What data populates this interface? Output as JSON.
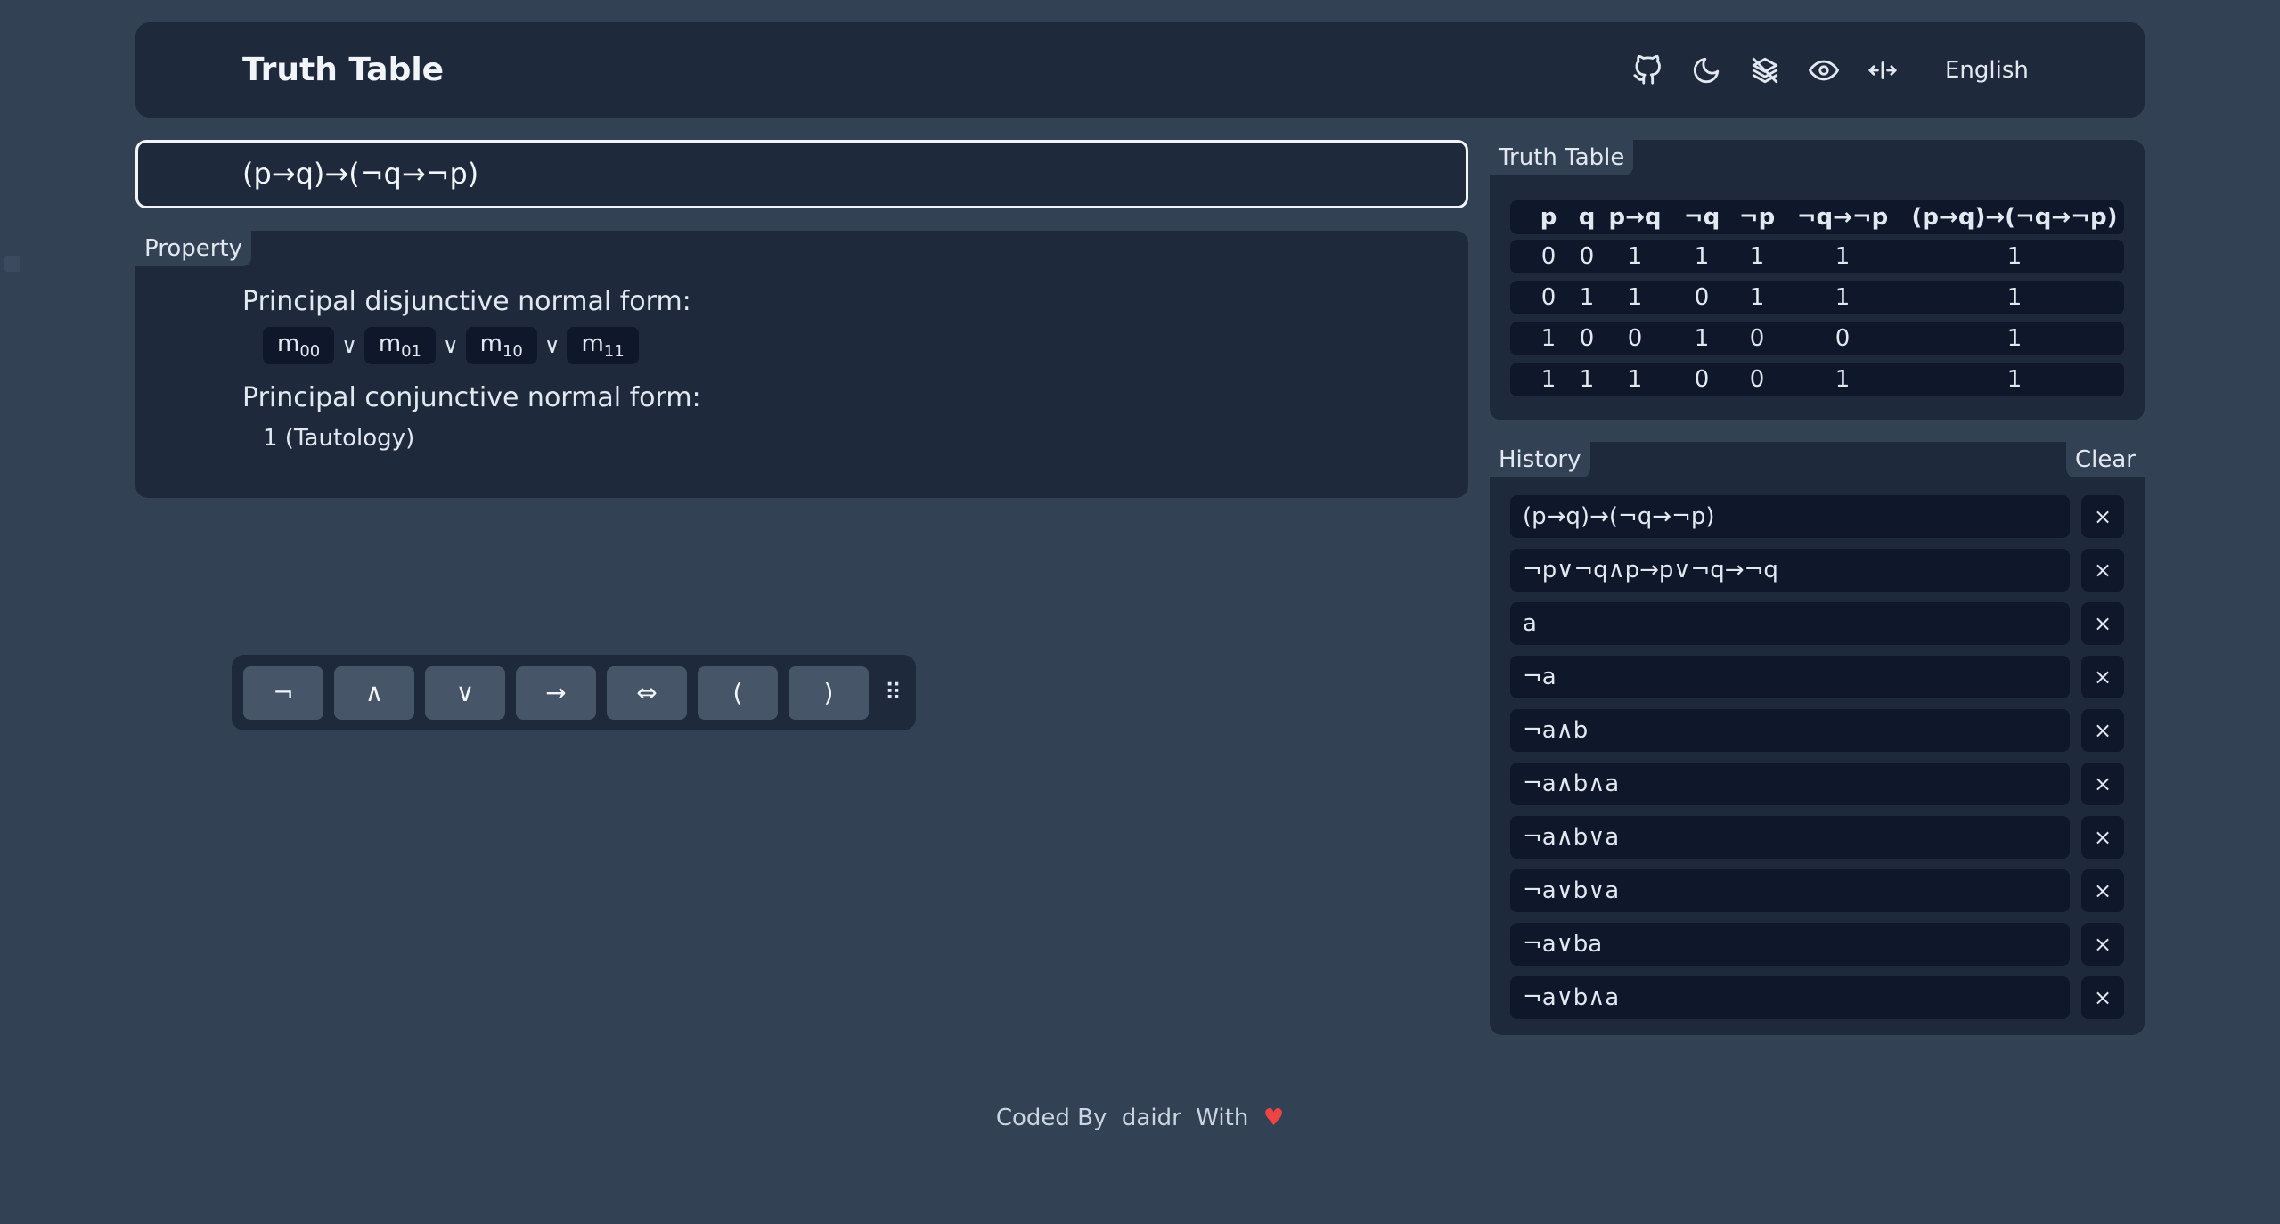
{
  "header": {
    "title": "Truth Table",
    "icons": [
      "github-icon",
      "moon-icon",
      "layers-off-icon",
      "eye-icon",
      "arrows-horizontal-icon"
    ],
    "language": "English"
  },
  "input": {
    "value": "(p→q)→(¬q→¬p)"
  },
  "property": {
    "tag": "Property",
    "pdnf_label": "Principal disjunctive normal form:",
    "minterms": [
      {
        "m": "m",
        "sub": "00"
      },
      {
        "m": "m",
        "sub": "01"
      },
      {
        "m": "m",
        "sub": "10"
      },
      {
        "m": "m",
        "sub": "11"
      }
    ],
    "or_symbol": "∨",
    "pcnf_label": "Principal conjunctive normal form:",
    "pcnf_value": "1 (Tautology)"
  },
  "keyboard": {
    "keys": [
      "¬",
      "∧",
      "∨",
      "→",
      "⇔",
      "(",
      ")"
    ],
    "drag_handle": "⠿"
  },
  "truth_table": {
    "tag": "Truth Table",
    "headers": [
      "p",
      "q",
      "p→q",
      "¬q",
      "¬p",
      "¬q→¬p",
      "(p→q)→(¬q→¬p)"
    ],
    "rows": [
      [
        "0",
        "0",
        "1",
        "1",
        "1",
        "1",
        "1"
      ],
      [
        "0",
        "1",
        "1",
        "0",
        "1",
        "1",
        "1"
      ],
      [
        "1",
        "0",
        "0",
        "1",
        "0",
        "0",
        "1"
      ],
      [
        "1",
        "1",
        "1",
        "0",
        "0",
        "1",
        "1"
      ]
    ]
  },
  "history": {
    "tag": "History",
    "clear_label": "Clear",
    "delete_symbol": "×",
    "items": [
      "(p→q)→(¬q→¬p)",
      "¬p∨¬q∧p→p∨¬q→¬q",
      "a",
      "¬a",
      "¬a∧b",
      "¬a∧b∧a",
      "¬a∧b∨a",
      "¬a∨b∨a",
      "¬a∨ba",
      "¬a∨b∧a"
    ]
  },
  "footer": {
    "coded_by": "Coded By",
    "author": "daidr",
    "with": "With",
    "heart": "♥"
  }
}
